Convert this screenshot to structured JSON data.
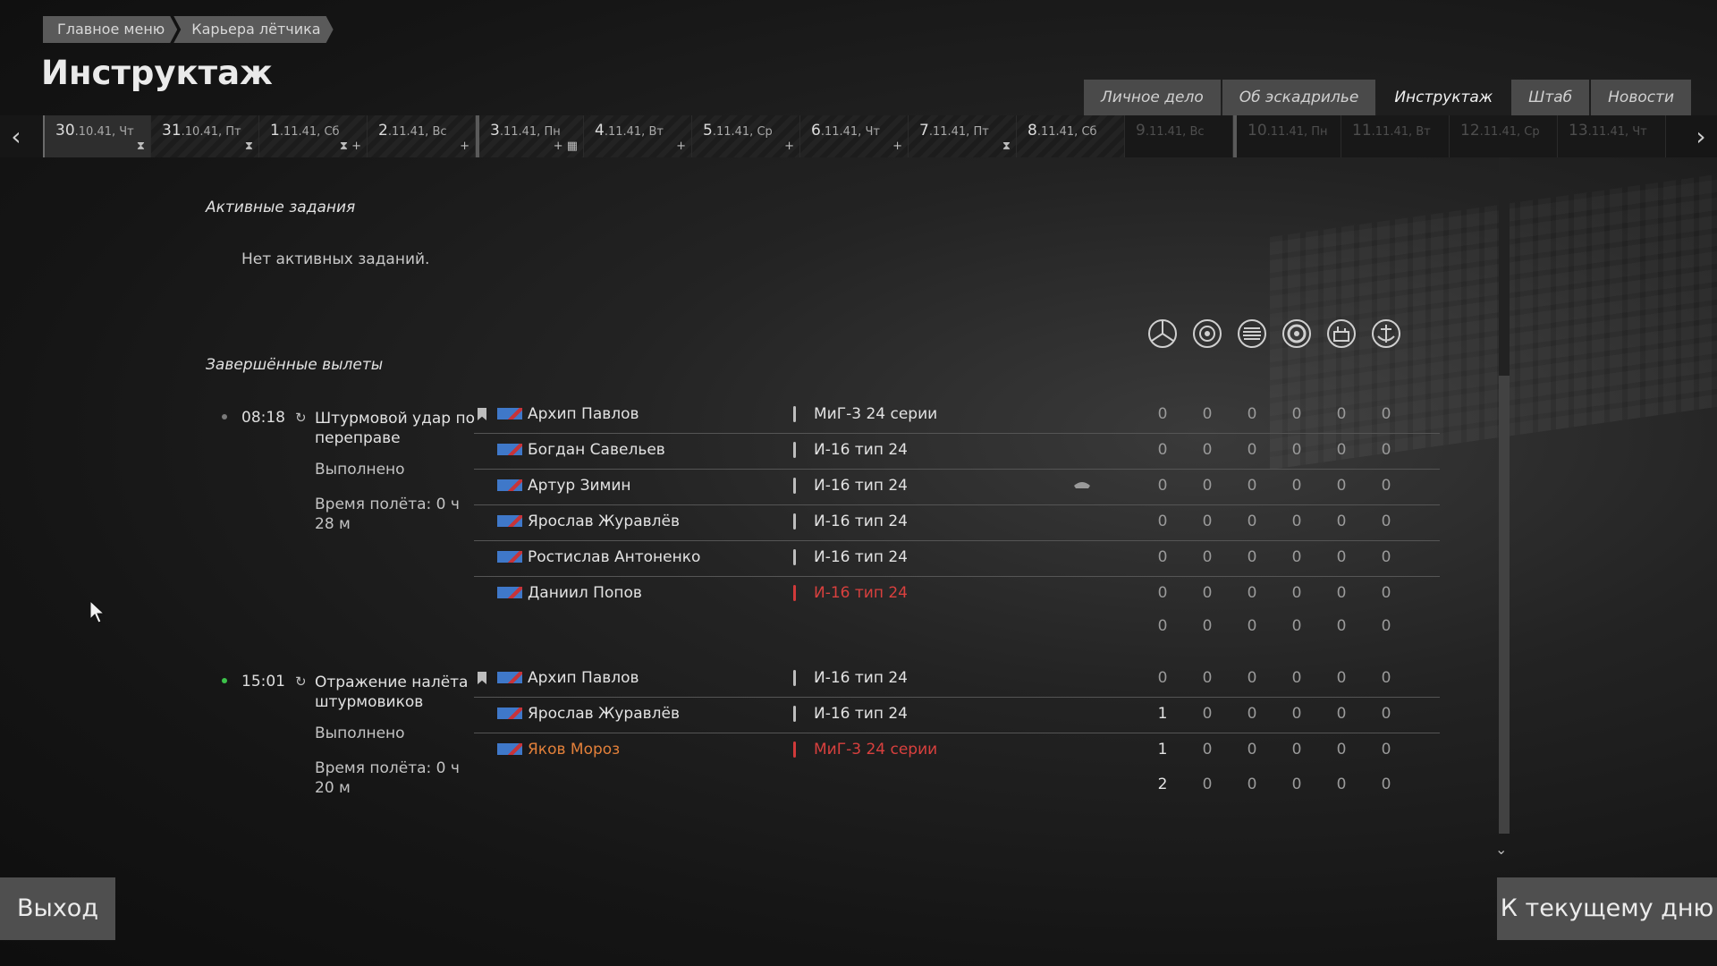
{
  "breadcrumb": [
    "Главное меню",
    "Карьера лётчика"
  ],
  "page_title": "Инструктаж",
  "tabs": [
    {
      "label": "Личное дело",
      "active": false
    },
    {
      "label": "Об эскадрилье",
      "active": false
    },
    {
      "label": "Инструктаж",
      "active": true
    },
    {
      "label": "Штаб",
      "active": false
    },
    {
      "label": "Новости",
      "active": false
    }
  ],
  "days": [
    {
      "num": "30",
      "rest": ".10.41, Чт",
      "state": "current"
    },
    {
      "num": "31",
      "rest": ".10.41, Пт",
      "state": "past"
    },
    {
      "num": "1",
      "rest": ".11.41, Сб",
      "state": "past"
    },
    {
      "num": "2",
      "rest": ".11.41, Вс",
      "state": "past"
    },
    {
      "num": "3",
      "rest": ".11.41, Пн",
      "state": "marked"
    },
    {
      "num": "4",
      "rest": ".11.41, Вт",
      "state": "past"
    },
    {
      "num": "5",
      "rest": ".11.41, Ср",
      "state": "past"
    },
    {
      "num": "6",
      "rest": ".11.41, Чт",
      "state": "past"
    },
    {
      "num": "7",
      "rest": ".11.41, Пт",
      "state": "past"
    },
    {
      "num": "8",
      "rest": ".11.41, Сб",
      "state": "past"
    },
    {
      "num": "9",
      "rest": ".11.41, Вс",
      "state": "future"
    },
    {
      "num": "10",
      "rest": ".11.41, Пн",
      "state": "future"
    },
    {
      "num": "11",
      "rest": ".11.41, Вт",
      "state": "future"
    },
    {
      "num": "12",
      "rest": ".11.41, Ср",
      "state": "future"
    },
    {
      "num": "13",
      "rest": ".11.41, Чт",
      "state": "future"
    }
  ],
  "active_tasks": {
    "title": "Активные задания",
    "empty_text": "Нет активных заданий."
  },
  "completed": {
    "title": "Завершённые вылеты",
    "stat_icons": [
      "air-kills-icon",
      "ground-kills-icon",
      "vehicle-kills-icon",
      "target-kills-icon",
      "building-kills-icon",
      "naval-kills-icon"
    ],
    "missions": [
      {
        "time": "08:18",
        "name": "Штурмовой удар по переправе",
        "status": "Выполнено",
        "flight_time": "Время полёта: 0 ч 28 м",
        "dot": "grey",
        "rows": [
          {
            "pilot": "Архип Павлов",
            "plane": "МиГ-3 24 серии",
            "stats": [
              "0",
              "0",
              "0",
              "0",
              "0",
              "0"
            ]
          },
          {
            "pilot": "Богдан Савельев",
            "plane": "И-16 тип 24",
            "stats": [
              "0",
              "0",
              "0",
              "0",
              "0",
              "0"
            ]
          },
          {
            "pilot": "Артур Зимин",
            "plane": "И-16 тип 24",
            "stats": [
              "0",
              "0",
              "0",
              "0",
              "0",
              "0"
            ]
          },
          {
            "pilot": "Ярослав Журавлёв",
            "plane": "И-16 тип 24",
            "stats": [
              "0",
              "0",
              "0",
              "0",
              "0",
              "0"
            ]
          },
          {
            "pilot": "Ростислав Антоненко",
            "plane": "И-16 тип 24",
            "stats": [
              "0",
              "0",
              "0",
              "0",
              "0",
              "0"
            ]
          },
          {
            "pilot": "Даниил Попов",
            "plane": "И-16 тип 24",
            "stats": [
              "0",
              "0",
              "0",
              "0",
              "0",
              "0"
            ]
          }
        ],
        "totals": [
          "0",
          "0",
          "0",
          "0",
          "0",
          "0"
        ]
      },
      {
        "time": "15:01",
        "name": "Отражение налёта штурмовиков",
        "status": "Выполнено",
        "flight_time": "Время полёта: 0 ч 20 м",
        "dot": "green",
        "rows": [
          {
            "pilot": "Архип Павлов",
            "plane": "И-16 тип 24",
            "stats": [
              "0",
              "0",
              "0",
              "0",
              "0",
              "0"
            ]
          },
          {
            "pilot": "Ярослав Журавлёв",
            "plane": "И-16 тип 24",
            "stats": [
              "1",
              "0",
              "0",
              "0",
              "0",
              "0"
            ]
          },
          {
            "pilot": "Яков Мороз",
            "plane": "МиГ-3 24 серии",
            "stats": [
              "1",
              "0",
              "0",
              "0",
              "0",
              "0"
            ]
          }
        ],
        "totals": [
          "2",
          "0",
          "0",
          "0",
          "0",
          "0"
        ]
      }
    ]
  },
  "buttons": {
    "exit": "Выход",
    "today": "К текущему дню"
  },
  "colors": {
    "accent_red": "#d9403e",
    "accent_orange": "#e3803a",
    "status_green": "#3cc24a"
  }
}
